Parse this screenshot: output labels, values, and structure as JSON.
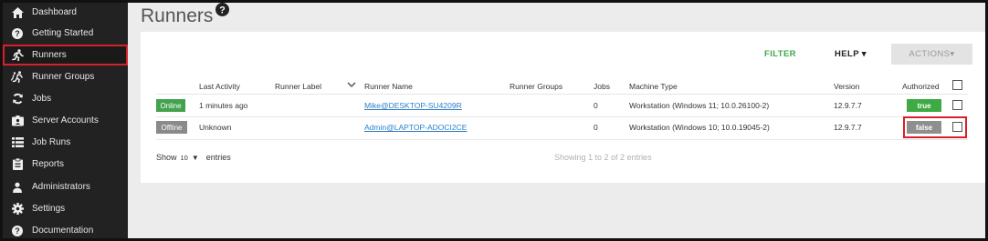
{
  "sidebar": {
    "items": [
      {
        "label": "Dashboard",
        "icon": "home-icon"
      },
      {
        "label": "Getting Started",
        "icon": "question-circle-icon"
      },
      {
        "label": "Runners",
        "icon": "running-person-icon"
      },
      {
        "label": "Runner Groups",
        "icon": "running-group-icon"
      },
      {
        "label": "Jobs",
        "icon": "sync-icon"
      },
      {
        "label": "Server Accounts",
        "icon": "id-card-icon"
      },
      {
        "label": "Job Runs",
        "icon": "list-icon"
      },
      {
        "label": "Reports",
        "icon": "clipboard-icon"
      },
      {
        "label": "Administrators",
        "icon": "user-icon"
      },
      {
        "label": "Settings",
        "icon": "gear-icon"
      },
      {
        "label": "Documentation",
        "icon": "question-circle-icon"
      }
    ],
    "active_index": 2
  },
  "page": {
    "title": "Runners",
    "help_icon": "question-circle-icon"
  },
  "toolbar": {
    "filter_label": "FILTER",
    "help_label": "HELP ▾",
    "actions_label": "ACTIONS▾"
  },
  "table": {
    "headers": {
      "last_activity": "Last Activity",
      "runner_label": "Runner Label",
      "runner_name": "Runner Name",
      "runner_groups": "Runner Groups",
      "jobs": "Jobs",
      "machine_type": "Machine Type",
      "version": "Version",
      "authorized": "Authorized"
    },
    "rows": [
      {
        "status": "Online",
        "last_activity": "1 minutes ago",
        "runner_label": "",
        "runner_name": "Mike@DESKTOP-SU4209R",
        "runner_groups": "",
        "jobs": "0",
        "machine_type": "Workstation (Windows 11; 10.0.26100-2)",
        "version": "12.9.7.7",
        "authorized": "true"
      },
      {
        "status": "Offline",
        "last_activity": "Unknown",
        "runner_label": "",
        "runner_name": "Admin@LAPTOP-ADOCI2CE",
        "runner_groups": "",
        "jobs": "0",
        "machine_type": "Workstation (Windows 10; 10.0.19045-2)",
        "version": "12.9.7.7",
        "authorized": "false"
      }
    ]
  },
  "footer": {
    "show_label": "Show",
    "page_size": "10",
    "entries_label": "entries",
    "showing_text": "Showing 1 to 2 of 2 entries"
  },
  "colors": {
    "sidebar_bg": "#222222",
    "accent_red": "#d9202a",
    "online_green": "#43a24f",
    "link_blue": "#2a7ec9"
  }
}
